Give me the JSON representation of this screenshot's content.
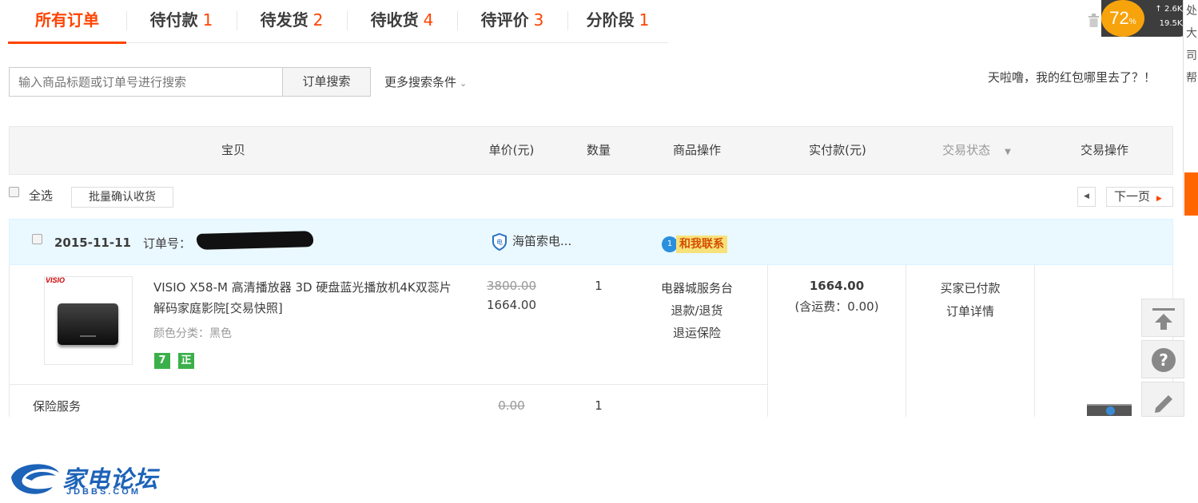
{
  "tabs": [
    {
      "label": "所有订单",
      "count": ""
    },
    {
      "label": "待付款",
      "count": "1"
    },
    {
      "label": "待发货",
      "count": "2"
    },
    {
      "label": "待收货",
      "count": "4"
    },
    {
      "label": "待评价",
      "count": "3"
    },
    {
      "label": "分阶段",
      "count": "1"
    }
  ],
  "speed_widget": {
    "percent": "72",
    "percent_sign": "%",
    "up_rate": "2.6",
    "down_rate": "19.5",
    "unit": "K/s"
  },
  "edge_strip": {
    "chars": [
      "处",
      "大",
      "司",
      "",
      "帮"
    ]
  },
  "search": {
    "placeholder": "输入商品标题或订单号进行搜索",
    "button": "订单搜索",
    "more": "更多搜索条件"
  },
  "promo_text": "天啦噜，我的红包哪里去了？！",
  "table_headers": {
    "item": "宝贝",
    "unit_price": "单价(元)",
    "quantity": "数量",
    "item_ops": "商品操作",
    "paid": "实付款(元)",
    "status": "交易状态",
    "trade_ops": "交易操作"
  },
  "toolbar": {
    "select_all": "全选",
    "batch_confirm": "批量确认收货",
    "next_page": "下一页"
  },
  "order": {
    "date": "2015-11-11",
    "order_no_label": "订单号：",
    "shop_name": "海笛索电...",
    "contact_label": "和我联系",
    "contact_badge": "1",
    "product": {
      "brand_logo": "VISIO",
      "title": "VISIO X58-M 高清播放器 3D 硬盘蓝光播放机4K双蕊片解码家庭影院[交易快照]",
      "color": "颜色分类：黑色",
      "badges": [
        "7",
        "正"
      ],
      "original_price": "3800.00",
      "price": "1664.00",
      "quantity": "1",
      "operations": [
        "电器城服务台",
        "退款/退货",
        "退运保险"
      ]
    },
    "paid_amount": "1664.00",
    "shipping": "(含运费：0.00)",
    "status": "买家已付款",
    "detail_link": "订单详情",
    "insurance": {
      "label": "保险服务",
      "price": "0.00",
      "quantity": "1"
    }
  },
  "side_tools": [
    "back-to-top",
    "help",
    "feedback"
  ],
  "watermark": {
    "text": "家电论坛",
    "sub": "JDBBS.COM"
  },
  "colors": {
    "accent": "#ff4400",
    "order_header_bg": "#eaf8ff",
    "badge_green": "#3bb04a",
    "brand_blue": "#1d63b8"
  }
}
